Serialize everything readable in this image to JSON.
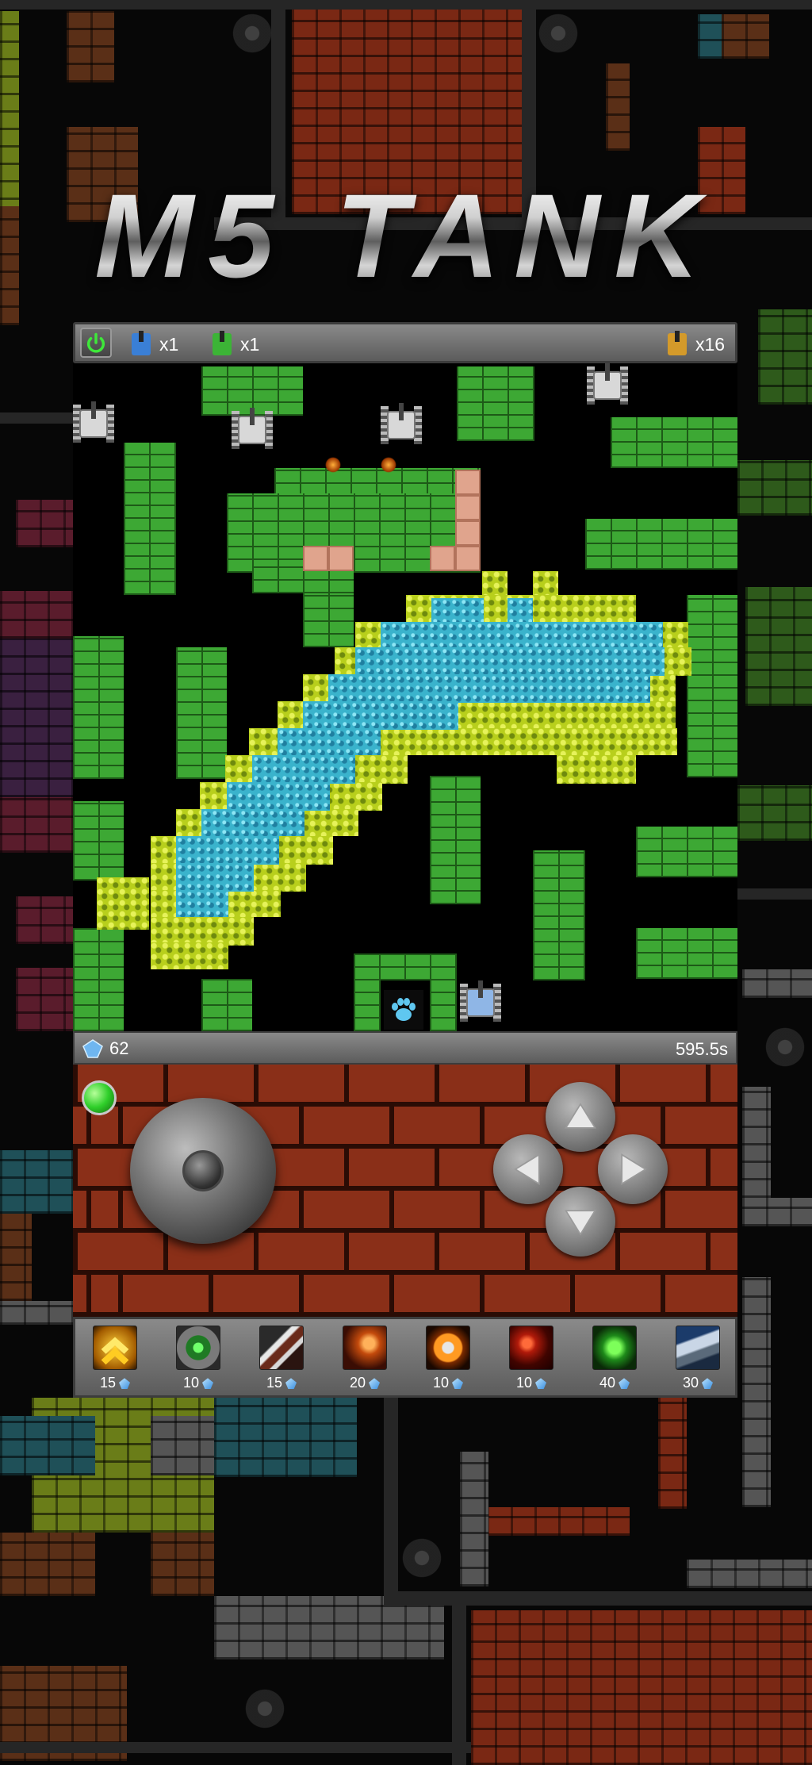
{
  "title": "M5 TANK",
  "top_bar": {
    "player1_lives": "x1",
    "player2_lives": "x1",
    "enemies_remaining": "x16"
  },
  "status_bar": {
    "crystals": "62",
    "timer": "595.5s"
  },
  "powerups": [
    {
      "icon": "rank-up-chevron-icon",
      "cost": "15"
    },
    {
      "icon": "shield-orb-icon",
      "cost": "10"
    },
    {
      "icon": "blades-icon",
      "cost": "15"
    },
    {
      "icon": "fire-shell-icon",
      "cost": "20"
    },
    {
      "icon": "spin-disc-icon",
      "cost": "10"
    },
    {
      "icon": "flame-whirl-icon",
      "cost": "10"
    },
    {
      "icon": "green-tank-icon",
      "cost": "40"
    },
    {
      "icon": "twin-cannon-icon",
      "cost": "30"
    }
  ],
  "colors": {
    "brick_green": "#3da834",
    "grass_yellow": "#b8cf1c",
    "water_blue": "#3ab3cc",
    "control_brick": "#8a2f18"
  }
}
